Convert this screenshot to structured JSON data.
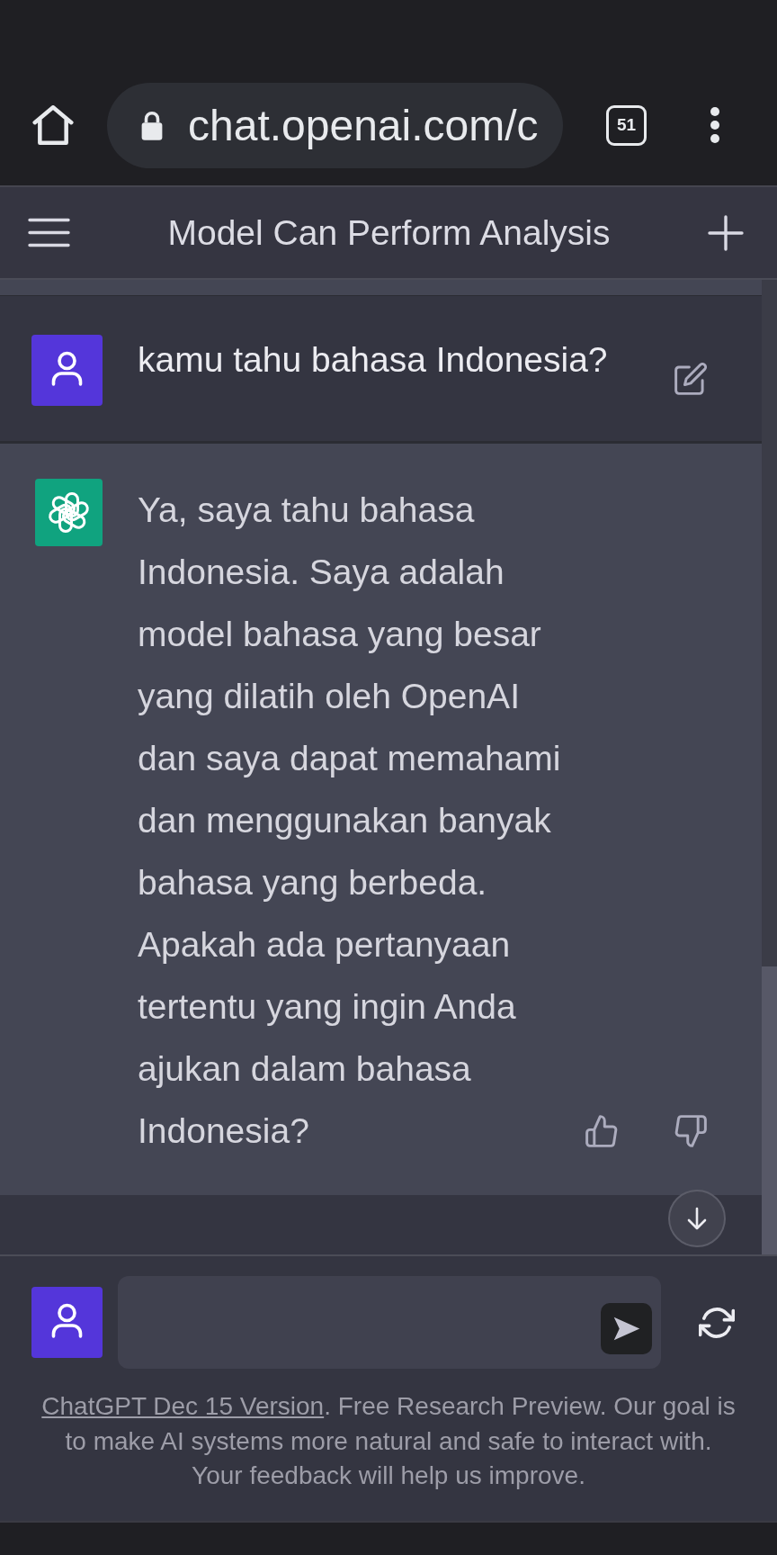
{
  "browser": {
    "url": "chat.openai.com/c",
    "tab_count": "51"
  },
  "header": {
    "title": "Model Can Perform Analysis"
  },
  "messages": [
    {
      "kind": "user",
      "text": "kamu tahu bahasa Indonesia?"
    },
    {
      "kind": "assistant",
      "text": "Ya, saya tahu bahasa Indonesia. Saya adalah model bahasa yang besar yang dilatih oleh OpenAI dan saya dapat memahami dan menggunakan banyak bahasa yang berbeda. Apakah ada pertanyaan tertentu yang ingin Anda ajukan dalam bahasa Indonesia?"
    }
  ],
  "footer": {
    "link": "ChatGPT Dec 15 Version",
    "text": ". Free Research Preview. Our goal is to make AI systems more natural and safe to interact with. Your feedback will help us improve."
  }
}
